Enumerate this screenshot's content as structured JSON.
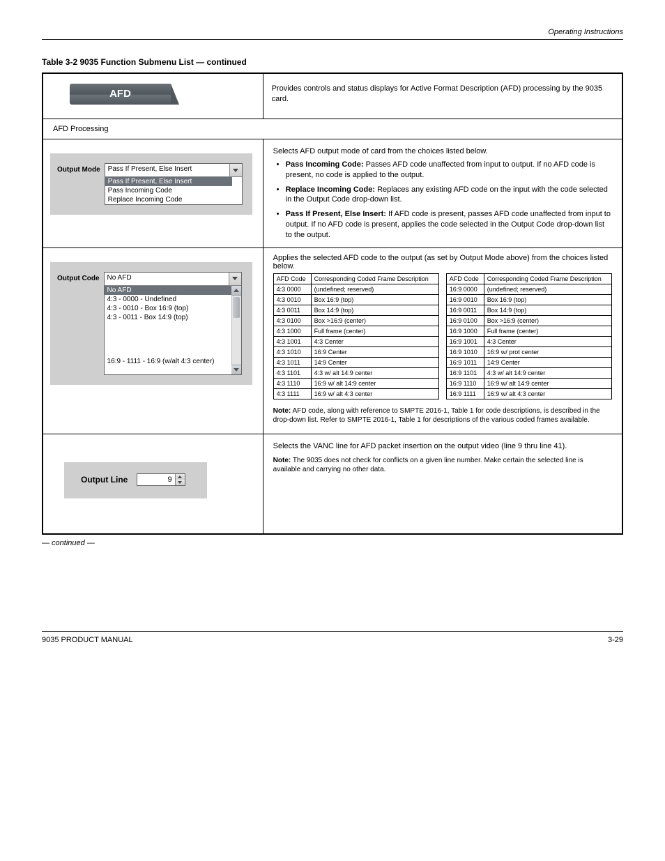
{
  "header": {
    "right": "Operating Instructions"
  },
  "table_caption": "Table 3-2  9035 Function Submenu List — continued",
  "afd_tab": "AFD",
  "afd_desc": "Provides controls and status displays for Active Format Description (AFD) processing by the 9035 card.",
  "afd_row_label": "AFD Processing",
  "output_mode": {
    "label": "Output Mode",
    "value": "Pass If Present, Else Insert",
    "options": [
      "Pass If Present, Else Insert",
      "Pass Incoming Code",
      "Replace Incoming Code"
    ],
    "desc_intro": "Selects AFD output mode of card from the choices listed below.",
    "bullets": [
      {
        "title": "Pass Incoming Code:",
        "body": "Passes AFD code unaffected from input to output. If no AFD code is present, no code is applied to the output."
      },
      {
        "title": "Replace Incoming Code:",
        "body": "Replaces any existing AFD code on the input with the code selected in the Output Code drop-down list."
      },
      {
        "title": "Pass If Present, Else Insert:",
        "body": "If AFD code is present, passes AFD code unaffected from input to output. If no AFD code is present, applies the code selected in the Output Code drop-down list to the output."
      }
    ]
  },
  "output_code": {
    "label": "Output Code",
    "value": "No AFD",
    "options_visible": [
      "No AFD",
      "4:3 - 0000 - Undefined",
      "4:3 - 0010 - Box 16:9 (top)",
      "4:3 - 0011 - Box 14:9 (top)"
    ],
    "last_option": "16:9 - 1111 - 16:9 (w/alt 4:3 center)",
    "desc": "Applies the selected AFD code to the output (as set by Output Mode above) from the choices listed below.",
    "codes_43": [
      {
        "code": "4:3  0000",
        "desc": "(undefined; reserved)"
      },
      {
        "code": "4:3  0010",
        "desc": "Box 16:9 (top)"
      },
      {
        "code": "4:3  0011",
        "desc": "Box 14:9 (top)"
      },
      {
        "code": "4:3  0100",
        "desc": "Box >16:9 (center)"
      },
      {
        "code": "4:3  1000",
        "desc": "Full frame (center)"
      },
      {
        "code": "4:3  1001",
        "desc": "4:3 Center"
      },
      {
        "code": "4:3  1010",
        "desc": "16:9 Center"
      },
      {
        "code": "4:3  1011",
        "desc": "14:9 Center"
      },
      {
        "code": "4:3  1101",
        "desc": "4:3 w/ alt 14:9 center"
      },
      {
        "code": "4:3  1110",
        "desc": "16:9 w/ alt 14:9 center"
      },
      {
        "code": "4:3  1111",
        "desc": "16:9 w/ alt 4:3 center"
      }
    ],
    "codes_169": [
      {
        "code": "16:9  0000",
        "desc": "(undefined; reserved)"
      },
      {
        "code": "16:9  0010",
        "desc": "Box 16:9 (top)"
      },
      {
        "code": "16:9  0011",
        "desc": "Box 14:9 (top)"
      },
      {
        "code": "16:9  0100",
        "desc": "Box >16:9 (center)"
      },
      {
        "code": "16:9  1000",
        "desc": "Full frame (center)"
      },
      {
        "code": "16:9  1001",
        "desc": "4:3 Center"
      },
      {
        "code": "16:9  1010",
        "desc": "16:9 w/ prot center"
      },
      {
        "code": "16:9  1011",
        "desc": "14:9 Center"
      },
      {
        "code": "16:9  1101",
        "desc": "4:3 w/ alt 14:9 center"
      },
      {
        "code": "16:9  1110",
        "desc": "16:9 w/ alt 14:9 center"
      },
      {
        "code": "16:9  1111",
        "desc": "16:9 w/ alt 4:3 center"
      }
    ],
    "table_headers": {
      "h1": "AFD Code",
      "h2": "Corresponding Coded Frame Description",
      "h3": "AFD Code",
      "h4": "Corresponding Coded Frame Description"
    },
    "note_label": "Note:",
    "note": "AFD code, along with reference to SMPTE 2016-1, Table 1 for code descriptions, is described in the drop-down list. Refer to SMPTE 2016-1, Table 1 for descriptions of the various coded frames available."
  },
  "output_line": {
    "label": "Output Line",
    "value": "9",
    "desc": "Selects the VANC line for AFD packet insertion on the output video (line 9 thru line 41).",
    "note_label": "Note:",
    "note": "The 9035 does not check for conflicts on a given line number. Make certain the selected line is available and carrying no other data."
  },
  "continued_text": "— continued —",
  "footer": {
    "left": "9035 PRODUCT MANUAL",
    "right": "3-29"
  }
}
